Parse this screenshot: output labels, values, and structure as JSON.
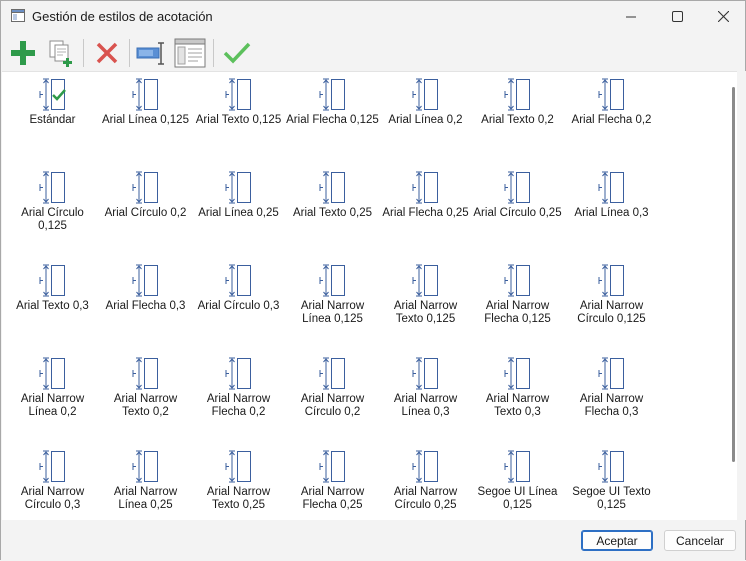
{
  "window": {
    "title": "Gestión de estilos de acotación",
    "controls": [
      "minimize-icon",
      "maximize-icon",
      "close-icon"
    ]
  },
  "toolbar": {
    "buttons": [
      {
        "name": "add-style-button",
        "icon": "plus-icon",
        "color": "#2e9a4a"
      },
      {
        "name": "copy-style-button",
        "icon": "copy-icon"
      },
      {
        "name": "delete-style-button",
        "icon": "delete-x-icon",
        "color": "#d9534f"
      },
      {
        "name": "rename-style-button",
        "icon": "rename-icon"
      },
      {
        "name": "edit-style-button",
        "icon": "window-edit-icon"
      },
      {
        "name": "set-current-button",
        "icon": "checkmark-icon",
        "color": "#5cc05c"
      }
    ]
  },
  "styles": [
    {
      "label": "Estándar",
      "current": true
    },
    {
      "label": "Arial Línea 0,125"
    },
    {
      "label": "Arial Texto 0,125"
    },
    {
      "label": "Arial Flecha 0,125"
    },
    {
      "label": "Arial Línea 0,2"
    },
    {
      "label": "Arial Texto 0,2"
    },
    {
      "label": "Arial Flecha 0,2"
    },
    {
      "label": "Arial Círculo 0,125"
    },
    {
      "label": "Arial Círculo 0,2"
    },
    {
      "label": "Arial Línea 0,25"
    },
    {
      "label": "Arial Texto 0,25"
    },
    {
      "label": "Arial Flecha 0,25"
    },
    {
      "label": "Arial Círculo 0,25"
    },
    {
      "label": "Arial Línea 0,3"
    },
    {
      "label": "Arial Texto 0,3"
    },
    {
      "label": "Arial Flecha 0,3"
    },
    {
      "label": "Arial Círculo 0,3"
    },
    {
      "label": "Arial Narrow Línea 0,125"
    },
    {
      "label": "Arial Narrow Texto 0,125"
    },
    {
      "label": "Arial Narrow Flecha 0,125"
    },
    {
      "label": "Arial Narrow Círculo 0,125"
    },
    {
      "label": "Arial Narrow Línea 0,2"
    },
    {
      "label": "Arial Narrow Texto 0,2"
    },
    {
      "label": "Arial Narrow Flecha 0,2"
    },
    {
      "label": "Arial Narrow Círculo 0,2"
    },
    {
      "label": "Arial Narrow Línea 0,3"
    },
    {
      "label": "Arial Narrow Texto 0,3"
    },
    {
      "label": "Arial Narrow Flecha 0,3"
    },
    {
      "label": "Arial Narrow Círculo 0,3"
    },
    {
      "label": "Arial Narrow Línea 0,25"
    },
    {
      "label": "Arial Narrow Texto 0,25"
    },
    {
      "label": "Arial Narrow Flecha 0,25"
    },
    {
      "label": "Arial Narrow Círculo 0,25"
    },
    {
      "label": "Segoe UI Línea 0,125"
    },
    {
      "label": "Segoe UI Texto 0,125"
    }
  ],
  "footer": {
    "ok_label": "Aceptar",
    "cancel_label": "Cancelar"
  },
  "colors": {
    "accent": "#2d6fc4",
    "dimension_icon": "#3b5f9e"
  }
}
